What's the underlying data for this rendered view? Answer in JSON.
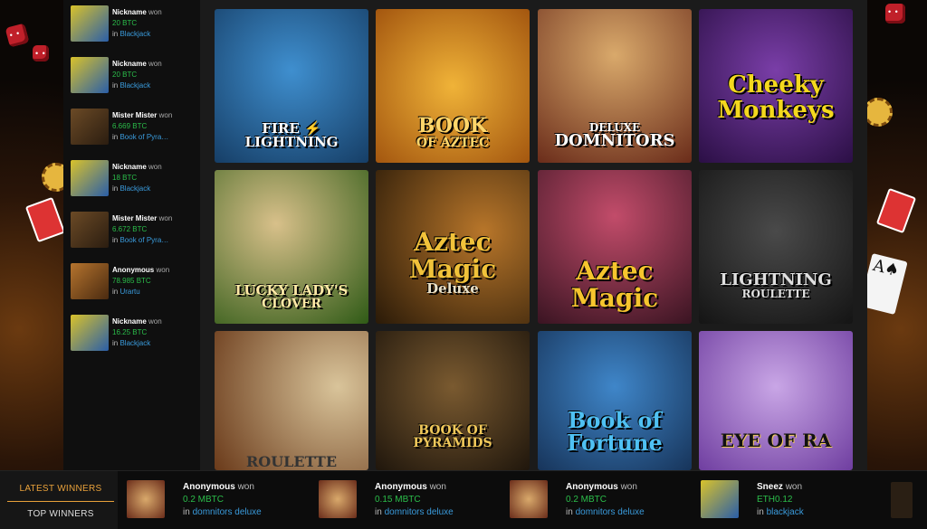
{
  "sidebar_winners": [
    {
      "name": "Nickname",
      "won": "won",
      "amount": "20 BTC",
      "in": "in",
      "game": "Blackjack",
      "thumb": "blackjack"
    },
    {
      "name": "Nickname",
      "won": "won",
      "amount": "20 BTC",
      "in": "in",
      "game": "Blackjack",
      "thumb": "blackjack"
    },
    {
      "name": "Mister Mister",
      "won": "won",
      "amount": "6.669 BTC",
      "in": "in",
      "game": "Book of Pyra…",
      "thumb": "pyramids"
    },
    {
      "name": "Nickname",
      "won": "won",
      "amount": "18 BTC",
      "in": "in",
      "game": "Blackjack",
      "thumb": "blackjack"
    },
    {
      "name": "Mister Mister",
      "won": "won",
      "amount": "6.672 BTC",
      "in": "in",
      "game": "Book of Pyra…",
      "thumb": "pyramids"
    },
    {
      "name": "Anonymous",
      "won": "won",
      "amount": "78.985 BTC",
      "in": "in",
      "game": "Urartu",
      "thumb": "urartu"
    },
    {
      "name": "Nickname",
      "won": "won",
      "amount": "16.25 BTC",
      "in": "in",
      "game": "Blackjack",
      "thumb": "blackjack"
    }
  ],
  "games": [
    {
      "title": "FIRE ⚡ LIGHTNING",
      "sub": "",
      "bg": "#1f5a86",
      "fg": "#ffffff",
      "size": "15px"
    },
    {
      "title": "BOOK",
      "sub": "OF AZTEC",
      "bg": "#d98a18",
      "fg": "#ffd66a",
      "size": "22px"
    },
    {
      "title": "DELUXE",
      "sub": "DOMNITORS",
      "bg": "#a36a3a",
      "fg": "#ffffff",
      "size": "12px"
    },
    {
      "title": "Cheeky",
      "sub": "Monkeys",
      "bg": "#4a1f6e",
      "fg": "#f4d81e",
      "size": "26px"
    },
    {
      "title": "LUCKY LADY'S",
      "sub": "CLOVER",
      "bg": "#4a7a26",
      "fg": "#ffe9a6",
      "size": "15px"
    },
    {
      "title": "Aztec Magic",
      "sub": "Deluxe",
      "bg": "#5b3a12",
      "fg": "#f1c23a",
      "size": "28px"
    },
    {
      "title": "Aztec",
      "sub": "Magic",
      "bg": "#7a2a3a",
      "fg": "#f6c52e",
      "size": "28px"
    },
    {
      "title": "LIGHTNING",
      "sub": "ROULETTE",
      "bg": "#2a2a2a",
      "fg": "#e0e0e0",
      "size": "18px"
    },
    {
      "title": "ROULETTE",
      "sub": "",
      "bg": "#8a5a36",
      "fg": "#333333",
      "size": "16px"
    },
    {
      "title": "BOOK OF PYRAMIDS",
      "sub": "",
      "bg": "#3b2e1e",
      "fg": "#f0c85a",
      "size": "14px"
    },
    {
      "title": "Book of",
      "sub": "Fortune",
      "bg": "#2c6fb0",
      "fg": "#4fc1f3",
      "size": "24px"
    },
    {
      "title": "EYE OF RA",
      "sub": "",
      "bg": "#9b6cc4",
      "fg": "#111111",
      "size": "20px"
    }
  ],
  "tabs": {
    "latest": "LATEST WINNERS",
    "top": "TOP WINNERS"
  },
  "bottom_winners": [
    {
      "name": "Anonymous",
      "won": "won",
      "amount": "0.2 MBTC",
      "in": "in",
      "game": "domnitors deluxe",
      "thumb": "domnitors"
    },
    {
      "name": "Anonymous",
      "won": "won",
      "amount": "0.15 MBTC",
      "in": "in",
      "game": "domnitors deluxe",
      "thumb": "domnitors"
    },
    {
      "name": "Anonymous",
      "won": "won",
      "amount": "0.2 MBTC",
      "in": "in",
      "game": "domnitors deluxe",
      "thumb": "domnitors"
    },
    {
      "name": "Sneez",
      "won": "won",
      "amount": "ETH0.12",
      "in": "in",
      "game": "blackjack",
      "thumb": "blackjack"
    }
  ],
  "colors": {
    "accent": "#e8a13a",
    "win_green": "#2bbd4a",
    "link_blue": "#3a9bdc"
  }
}
